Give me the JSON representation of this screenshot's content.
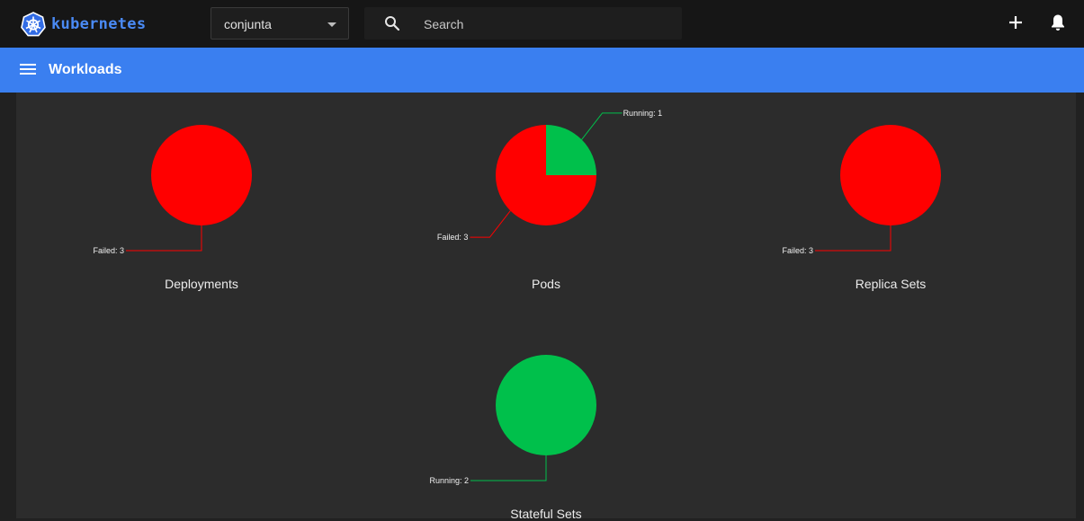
{
  "header": {
    "logo_text": "kubernetes",
    "namespace": "conjunta",
    "search_placeholder": "Search",
    "icons": [
      "kubernetes-logo-icon",
      "chevron-down-icon",
      "search-icon",
      "plus-icon",
      "bell-icon"
    ]
  },
  "nav": {
    "title": "Workloads",
    "menu_icon": "hamburger-menu-icon"
  },
  "colors": {
    "accent": "#3a7ff0",
    "failed": "#ff0000",
    "running": "#00c04b"
  },
  "chart_data": [
    {
      "type": "pie",
      "title": "Deployments",
      "slices": [
        {
          "label": "Failed",
          "value": 3,
          "display": "Failed: 3",
          "color": "#ff0000"
        }
      ]
    },
    {
      "type": "pie",
      "title": "Pods",
      "slices": [
        {
          "label": "Running",
          "value": 1,
          "display": "Running: 1",
          "color": "#00c04b"
        },
        {
          "label": "Failed",
          "value": 3,
          "display": "Failed: 3",
          "color": "#ff0000"
        }
      ]
    },
    {
      "type": "pie",
      "title": "Replica Sets",
      "slices": [
        {
          "label": "Failed",
          "value": 3,
          "display": "Failed: 3",
          "color": "#ff0000"
        }
      ]
    },
    {
      "type": "pie",
      "title": "Stateful Sets",
      "slices": [
        {
          "label": "Running",
          "value": 2,
          "display": "Running: 2",
          "color": "#00c04b"
        }
      ]
    }
  ]
}
